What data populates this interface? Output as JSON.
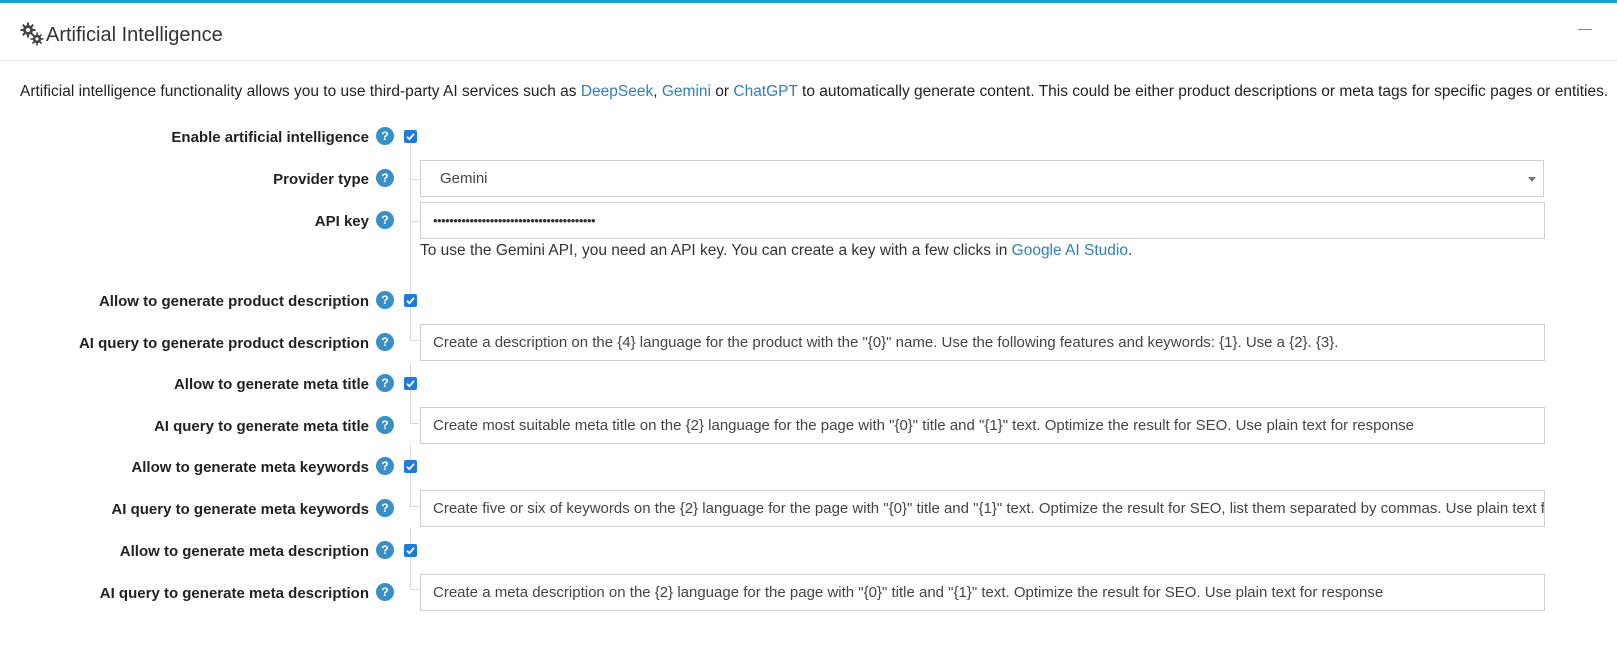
{
  "header": {
    "title": "Artificial Intelligence",
    "icon": "gears-icon",
    "collapse_icon": "minus-icon"
  },
  "intro": {
    "text_before": "Artificial intelligence functionality allows you to use third-party AI services such as ",
    "link1": "DeepSeek",
    "sep1": ", ",
    "link2": "Gemini",
    "sep2": " or ",
    "link3": "ChatGPT",
    "text_after": " to automatically generate content. This could be either product descriptions or meta tags for specific pages or entities."
  },
  "form": {
    "enable_ai": {
      "label": "Enable artificial intelligence",
      "checked": true
    },
    "provider_type": {
      "label": "Provider type",
      "value": "Gemini"
    },
    "api_key": {
      "label": "API key",
      "value": "••••••••••••••••••••••••••••••••••••••••",
      "hint_before": "To use the Gemini API, you need an API key. You can create a key with a few clicks in ",
      "hint_link": "Google AI Studio",
      "hint_after": "."
    },
    "allow_product_desc": {
      "label": "Allow to generate product description",
      "checked": true
    },
    "query_product_desc": {
      "label": "AI query to generate product description",
      "value": "Create a description on the {4} language for the product with the \"{0}\" name. Use the following features and keywords: {1}. Use a {2}. {3}."
    },
    "allow_meta_title": {
      "label": "Allow to generate meta title",
      "checked": true
    },
    "query_meta_title": {
      "label": "AI query to generate meta title",
      "value": "Create most suitable meta title on the {2} language for the page with \"{0}\" title and \"{1}\" text. Optimize the result for SEO. Use plain text for response"
    },
    "allow_meta_keywords": {
      "label": "Allow to generate meta keywords",
      "checked": true
    },
    "query_meta_keywords": {
      "label": "AI query to generate meta keywords",
      "value": "Create five or six of keywords on the {2} language for the page with \"{0}\" title and \"{1}\" text. Optimize the result for SEO, list them separated by commas. Use plain text for response"
    },
    "allow_meta_desc": {
      "label": "Allow to generate meta description",
      "checked": true
    },
    "query_meta_desc": {
      "label": "AI query to generate meta description",
      "value": "Create a meta description on the {2} language for the page with \"{0}\" title and \"{1}\" text. Optimize the result for SEO. Use plain text for response"
    },
    "help_glyph": "?"
  },
  "colors": {
    "accent_border": "#17a2cf",
    "link": "#2f7fb8",
    "help_badge": "#3a8fc7",
    "checkbox": "#1f7bd6"
  }
}
